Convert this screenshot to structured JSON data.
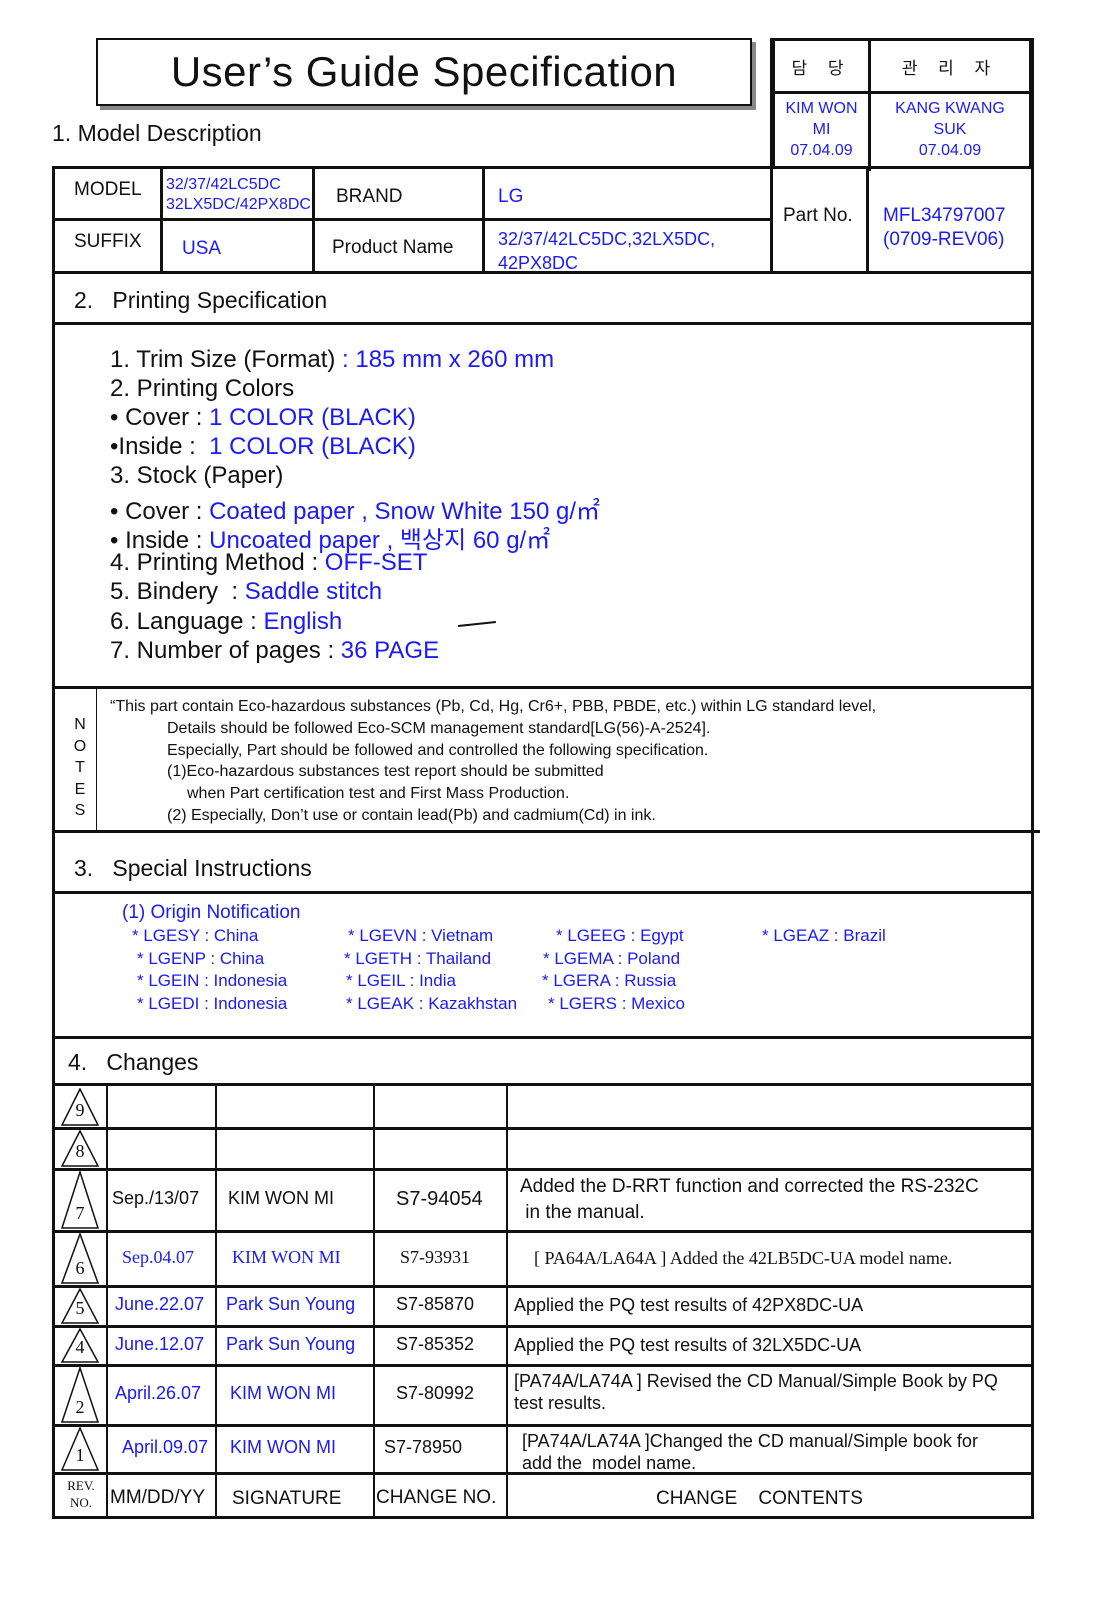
{
  "header": {
    "title": "User’s Guide Specification",
    "section1_label": "1. Model Description"
  },
  "signoff": {
    "col1_header": "담 당",
    "col2_header": "관 리 자",
    "col1_name_line1": "KIM WON",
    "col1_name_line2": "MI",
    "col1_date": "07.04.09",
    "col2_name_line1": "KANG KWANG",
    "col2_name_line2": "SUK",
    "col2_date": "07.04.09"
  },
  "model_table": {
    "model_label": "MODEL",
    "model_value_line1": "32/37/42LC5DC",
    "model_value_line2": "32LX5DC/42PX8DC",
    "brand_label": "BRAND",
    "brand_value": "LG",
    "suffix_label": "SUFFIX",
    "suffix_value": "USA",
    "product_name_label": "Product Name",
    "product_name_line1": "32/37/42LC5DC,32LX5DC,",
    "product_name_line2": "42PX8DC",
    "part_no_label": "Part No.",
    "part_no_value": "MFL34797007",
    "part_no_rev": "(0709-REV06)"
  },
  "printing": {
    "section_label": "2.   Printing Specification",
    "lines": [
      {
        "label": "1. Trim Size (Format)",
        "value": " : 185 mm x 260 mm"
      },
      {
        "label": "2. Printing Colors",
        "value": ""
      },
      {
        "label": "• Cover : ",
        "value": "1 COLOR (BLACK)"
      },
      {
        "label": "•Inside :  ",
        "value": "1 COLOR (BLACK)"
      },
      {
        "label": "3. Stock (Paper)",
        "value": ""
      },
      {
        "label": "• Cover : ",
        "value": "Coated paper , Snow White 150 g/㎡"
      },
      {
        "label": "• Inside : ",
        "value": "Uncoated paper , 백상지 60 g/㎡"
      },
      {
        "label": "4. Printing Method : ",
        "value": "OFF-SET"
      },
      {
        "label": "5. Bindery  : ",
        "value": "Saddle stitch"
      },
      {
        "label": "6. Language : ",
        "value": "English"
      },
      {
        "label": "7. Number of pages : ",
        "value": "36 PAGE"
      }
    ]
  },
  "notes": {
    "side_label": [
      "N",
      "O",
      "T",
      "E",
      "S"
    ],
    "lines": [
      "“This part contain Eco-hazardous substances (Pb, Cd, Hg, Cr6+, PBB, PBDE, etc.) within LG standard level,",
      "Details should be followed Eco-SCM management standard[LG(56)-A-2524].",
      "Especially, Part should be followed and controlled the following specification.",
      "(1)Eco-hazardous substances test report should be submitted",
      "when  Part certification test and First Mass Production.",
      "(2) Especially, Don’t use or contain lead(Pb) and cadmium(Cd) in ink."
    ]
  },
  "special": {
    "section_label": "3.   Special Instructions",
    "origin_title": "(1) Origin Notification",
    "origins": [
      [
        "* LGESY : China",
        "* LGEVN : Vietnam",
        "* LGEEG : Egypt",
        "* LGEAZ : Brazil"
      ],
      [
        "* LGENP : China",
        "* LGETH : Thailand",
        "* LGEMA : Poland",
        ""
      ],
      [
        "* LGEIN : Indonesia",
        "* LGEIL : India",
        "* LGERA : Russia",
        ""
      ],
      [
        "* LGEDI : Indonesia",
        "* LGEAK : Kazakhstan",
        "* LGERS : Mexico",
        ""
      ]
    ]
  },
  "changes": {
    "section_label": "4.   Changes",
    "rows": [
      {
        "rev": "9",
        "date": "",
        "signature": "",
        "change_no": "",
        "content_line1": "",
        "content_line2": ""
      },
      {
        "rev": "8",
        "date": "",
        "signature": "",
        "change_no": "",
        "content_line1": "",
        "content_line2": ""
      },
      {
        "rev": "7",
        "date": "Sep./13/07",
        "signature": "KIM WON MI",
        "change_no": "S7-94054",
        "content_line1": "Added the D-RRT function and corrected the RS-232C",
        "content_line2": " in the manual."
      },
      {
        "rev": "6",
        "date": "Sep.04.07",
        "signature": "KIM WON MI",
        "change_no": "S7-93931",
        "content_line1": "[ PA64A/LA64A ] Added the 42LB5DC-UA model name.",
        "content_line2": ""
      },
      {
        "rev": "5",
        "date": "June.22.07",
        "signature": "Park Sun Young",
        "change_no": "S7-85870",
        "content_line1": "Applied the PQ test results of 42PX8DC-UA",
        "content_line2": ""
      },
      {
        "rev": "4",
        "date": "June.12.07",
        "signature": "Park Sun Young",
        "change_no": "S7-85352",
        "content_line1": "Applied the PQ test results of 32LX5DC-UA",
        "content_line2": ""
      },
      {
        "rev": "2",
        "date": "April.26.07",
        "signature": "KIM WON MI",
        "change_no": "S7-80992",
        "content_line1": "[PA74A/LA74A ] Revised the CD Manual/Simple Book by PQ",
        "content_line2": "test results."
      },
      {
        "rev": "1",
        "date": "April.09.07",
        "signature": "KIM WON MI",
        "change_no": "S7-78950",
        "content_line1": "[PA74A/LA74A ]Changed the CD manual/Simple book for",
        "content_line2": "add the  model name."
      }
    ],
    "footer": {
      "rev_line1": "REV.",
      "rev_line2": "NO.",
      "date": "MM/DD/YY",
      "signature": "SIGNATURE",
      "change_no": "CHANGE NO.",
      "contents": "CHANGE    CONTENTS"
    }
  }
}
